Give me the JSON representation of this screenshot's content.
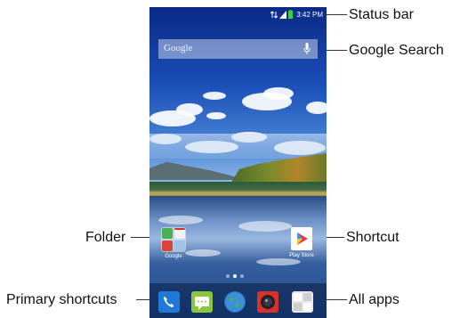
{
  "status_bar": {
    "time": "3:42 PM"
  },
  "search": {
    "placeholder": "Google"
  },
  "home": {
    "folder_label": "Google",
    "shortcut_label": "Play Store",
    "pages": 3,
    "current_page": 2
  },
  "dock": {
    "icons": [
      "phone-icon",
      "messaging-icon",
      "browser-icon",
      "camera-icon",
      "all-apps-icon"
    ]
  },
  "callouts": {
    "status_bar": "Status bar",
    "google_search": "Google Search",
    "folder": "Folder",
    "shortcut": "Shortcut",
    "primary_shortcuts": "Primary shortcuts",
    "all_apps": "All apps"
  },
  "colors": {
    "phone_icon": "#1e7ad6",
    "messaging_icon": "#8cc63f",
    "browser_icon": "#2a6db8",
    "camera_icon": "#d9312c"
  }
}
